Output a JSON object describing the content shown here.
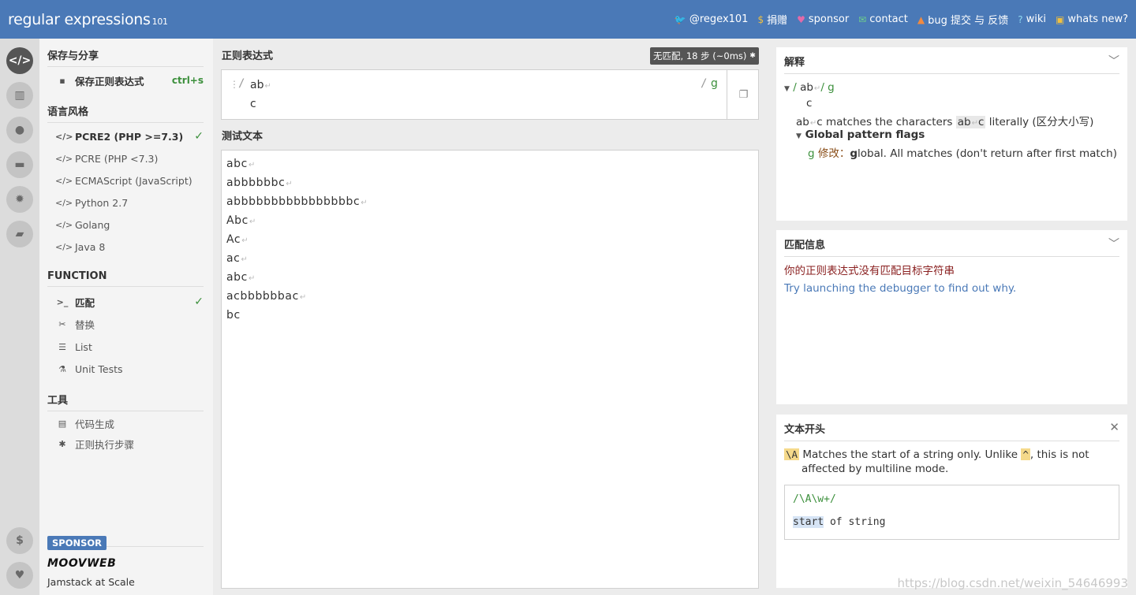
{
  "header": {
    "brand": "regular expressions",
    "version": "101",
    "nav": [
      {
        "icon": "twitter-icon",
        "label": "@regex101"
      },
      {
        "icon": "dollar-icon",
        "label": "捐赠"
      },
      {
        "icon": "heart-icon",
        "label": "sponsor"
      },
      {
        "icon": "mail-icon",
        "label": "contact"
      },
      {
        "icon": "warning-icon",
        "label": "bug 提交 与 反馈"
      },
      {
        "icon": "help-icon",
        "label": "wiki"
      },
      {
        "icon": "news-icon",
        "label": "whats new?"
      }
    ]
  },
  "rail": [
    "code-icon",
    "library-icon",
    "user-icon",
    "gamepad-icon",
    "settings-icon",
    "chat-icon",
    "dollar-icon",
    "heart-icon"
  ],
  "sidebar": {
    "save_section": "保存与分享",
    "save_item": {
      "label": "保存正则表达式",
      "shortcut": "ctrl+s"
    },
    "flavor_section": "语言风格",
    "flavors": [
      {
        "label": "PCRE2 (PHP >=7.3)",
        "selected": true
      },
      {
        "label": "PCRE (PHP <7.3)"
      },
      {
        "label": "ECMAScript (JavaScript)"
      },
      {
        "label": "Python 2.7"
      },
      {
        "label": "Golang"
      },
      {
        "label": "Java 8"
      }
    ],
    "function_section": "FUNCTION",
    "functions": [
      {
        "label": "匹配",
        "selected": true
      },
      {
        "label": "替换"
      },
      {
        "label": "List"
      },
      {
        "label": "Unit Tests"
      }
    ],
    "tools_section": "工具",
    "tools": [
      {
        "label": "代码生成"
      },
      {
        "label": "正则执行步骤"
      }
    ],
    "sponsor": {
      "badge": "SPONSOR",
      "logo": "MOOVWEB",
      "tagline": "Jamstack at Scale"
    }
  },
  "regex": {
    "title": "正则表达式",
    "match_info": "无匹配, 18 步 (~0ms)",
    "open_delim": "/",
    "line1": "ab",
    "line2": "c",
    "close_delim": "/",
    "flags": "g"
  },
  "test": {
    "title": "测试文本",
    "lines": [
      "abc",
      "abbbbbbc",
      "abbbbbbbbbbbbbbbbc",
      "Abc",
      "Ac",
      "ac",
      "abc",
      "acbbbbbbac",
      "bc"
    ]
  },
  "explanation": {
    "title": "解释",
    "regex_open": "/",
    "regex_part1": "ab",
    "regex_close": "/",
    "regex_flags": "g",
    "regex_line2": "c",
    "literal_a": "ab",
    "literal_b": "c",
    "literal_desc": "matches the characters",
    "literal_c": "ab",
    "literal_d": "c",
    "literal_suffix": "literally (区分大小写)",
    "flags_title": "Global pattern flags",
    "flag_g": "g",
    "flag_mod": "修改：",
    "flag_bold": "g",
    "flag_desc": "lobal. All matches (don't return after first match)"
  },
  "match_panel": {
    "title": "匹配信息",
    "message": "你的正则表达式没有匹配目标字符串",
    "link": "Try launching the debugger to find out why."
  },
  "quickref": {
    "title": "文本开头",
    "token": "\\A",
    "desc1": "Matches the start of a string only. Unlike",
    "caret": "^",
    "desc2": ", this is not",
    "desc3": "affected by multiline mode.",
    "example_regex": "/\\A\\w+/",
    "example_sel": "start",
    "example_rest": " of string"
  },
  "watermark": "https://blog.csdn.net/weixin_54646993"
}
